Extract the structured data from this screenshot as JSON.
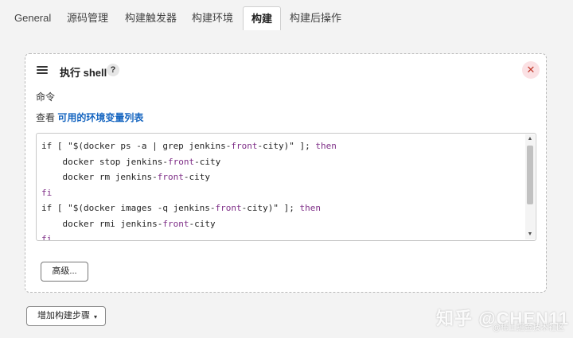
{
  "tabs": [
    {
      "label": "General"
    },
    {
      "label": "源码管理"
    },
    {
      "label": "构建触发器"
    },
    {
      "label": "构建环境"
    },
    {
      "label": "构建",
      "active": true
    },
    {
      "label": "构建后操作"
    }
  ],
  "build_step": {
    "title": "执行 shell",
    "help_glyph": "?",
    "close_glyph": "✕",
    "command_label": "命令",
    "env_prefix": "查看",
    "env_link": "可用的环境变量列表",
    "code_lines": [
      {
        "parts": [
          {
            "t": "if [ \"$(docker ps -a | grep jenkins-",
            "c": "plain"
          },
          {
            "t": "front",
            "c": "kw"
          },
          {
            "t": "-city)\" ]; ",
            "c": "plain"
          },
          {
            "t": "then",
            "c": "kw"
          }
        ]
      },
      {
        "parts": [
          {
            "t": "    docker stop jenkins-",
            "c": "plain"
          },
          {
            "t": "front",
            "c": "kw"
          },
          {
            "t": "-city",
            "c": "plain"
          }
        ]
      },
      {
        "parts": [
          {
            "t": "    docker rm jenkins-",
            "c": "plain"
          },
          {
            "t": "front",
            "c": "kw"
          },
          {
            "t": "-city",
            "c": "plain"
          }
        ]
      },
      {
        "parts": [
          {
            "t": "fi",
            "c": "kw"
          }
        ]
      },
      {
        "parts": [
          {
            "t": "if [ \"$(docker images -q jenkins-",
            "c": "plain"
          },
          {
            "t": "front",
            "c": "kw"
          },
          {
            "t": "-city)\" ]; ",
            "c": "plain"
          },
          {
            "t": "then",
            "c": "kw"
          }
        ]
      },
      {
        "parts": [
          {
            "t": "    docker rmi jenkins-",
            "c": "plain"
          },
          {
            "t": "front",
            "c": "kw"
          },
          {
            "t": "-city",
            "c": "plain"
          }
        ]
      },
      {
        "parts": [
          {
            "t": "fi",
            "c": "kw"
          }
        ]
      }
    ],
    "advanced_label": "高级..."
  },
  "add_step_label": "增加构建步骤",
  "add_step_caret": "▾",
  "scroll_up_glyph": "▲",
  "scroll_down_glyph": "▼",
  "watermark": {
    "main": "知乎 @CHEN11",
    "sub": "@稀土掘金技术社区"
  },
  "colors": {
    "link": "#1565c0",
    "keyword": "#7d2c86",
    "close_bg": "#fbe1e4",
    "close_fg": "#c0392b"
  }
}
